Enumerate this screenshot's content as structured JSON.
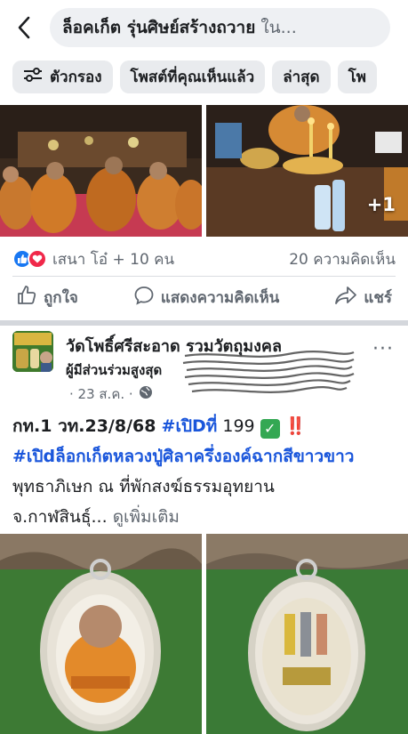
{
  "search": {
    "query": "ล็อคเก็ต รุ่นศิษย์สร้างถวาย",
    "suffix": "ใน..."
  },
  "chips": [
    {
      "label": "ตัวกรอง",
      "icon": "filter-sliders-icon"
    },
    {
      "label": "โพสต์ที่คุณเห็นแล้ว"
    },
    {
      "label": "ล่าสุด"
    },
    {
      "label": "โพ"
    }
  ],
  "photos": {
    "extra_count": "+1"
  },
  "reactions": {
    "names": "เสนา โอ๋ + 10 คน",
    "comments": "20 ความคิดเห็น"
  },
  "actions": {
    "like": "ถูกใจ",
    "comment": "แสดงความคิดเห็น",
    "share": "แชร์"
  },
  "post": {
    "page_name": "วัดโพธิ์ศรีสะอาด รวมวัตถุมงคล",
    "role": "ผู้มีส่วนร่วมสูงสุด",
    "date": "· 23 ส.ค. ·",
    "more": "···",
    "line1_a": "กท.1 วท.23/8/68",
    "line1_tag": "#เปิDที่",
    "line1_num": "199",
    "line1_check": "✓",
    "line1_bang": "‼️",
    "line2_tag": "#เปิdล็อกเก็ตหลวงปู่ศิลาครึ่งองค์ฉากสีขาวขาว",
    "line3": "พุทธาภิเษก ณ ที่พักสงฆ์ธรรมอุทยาน",
    "line4": "จ.กาฬสินธุ์...",
    "see_more": "ดูเพิ่มเติม"
  },
  "colors": {
    "accent": "#1877f2",
    "hashtag": "#1a56db",
    "love": "#f0284a",
    "check_green": "#34a853"
  }
}
